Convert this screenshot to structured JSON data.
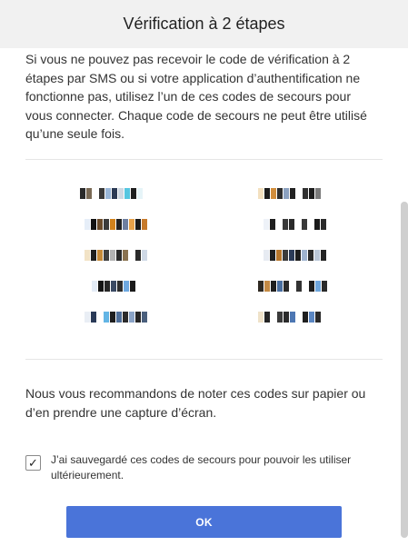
{
  "dialog": {
    "title": "Vérification à 2 étapes",
    "intro_text": "Si vous ne pouvez pas recevoir le code de vérification à 2 étapes par SMS ou si votre application d’authentification ne fonctionne pas, utilisez l’un de ces codes de secours pour vous connecter. Chaque code de secours ne peut être utilisé qu’une seule fois.",
    "recommendation_text": "Nous vous recommandons de noter ces codes sur papier ou d’en prendre une capture d’écran.",
    "checkbox": {
      "checked": true,
      "check_glyph": "✓",
      "label": "J’ai sauvegardé ces codes de secours pour pouvoir les utiliser ultérieurement."
    },
    "ok_button_label": "OK"
  },
  "colors": {
    "header_bg": "#f1f1f1",
    "button_bg": "#4a74d9",
    "button_text": "#ffffff"
  }
}
